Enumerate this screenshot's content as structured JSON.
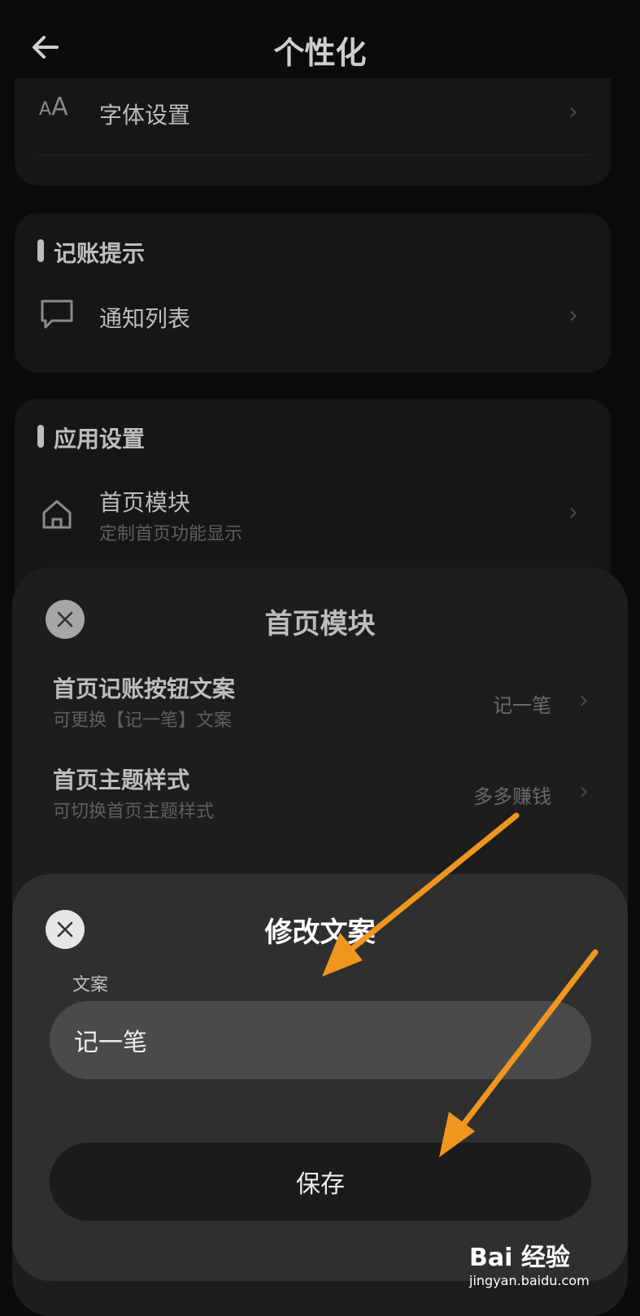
{
  "header": {
    "title": "个性化"
  },
  "font_settings": {
    "label": "字体设置"
  },
  "reminder_section": {
    "title": "记账提示",
    "items": [
      {
        "label": "通知列表"
      }
    ]
  },
  "app_settings_section": {
    "title": "应用设置",
    "items": [
      {
        "label": "首页模块",
        "subtitle": "定制首页功能显示"
      }
    ]
  },
  "home_module_sheet": {
    "title": "首页模块",
    "rows": [
      {
        "label": "首页记账按钮文案",
        "subtitle": "可更换【记一笔】文案",
        "value": "记一笔"
      },
      {
        "label": "首页主题样式",
        "subtitle": "可切换首页主题样式",
        "value": "多多赚钱"
      }
    ]
  },
  "edit_sheet": {
    "title": "修改文案",
    "field_label": "文案",
    "field_value": "记一笔",
    "save_label": "保存"
  },
  "watermark": {
    "brand": "Bai 经验",
    "url": "jingyan.baidu.com"
  },
  "colors": {
    "annotation_arrow": "#f0961e",
    "sheet_bg": "#2f2f2f",
    "input_bg": "#4a4a4a"
  }
}
